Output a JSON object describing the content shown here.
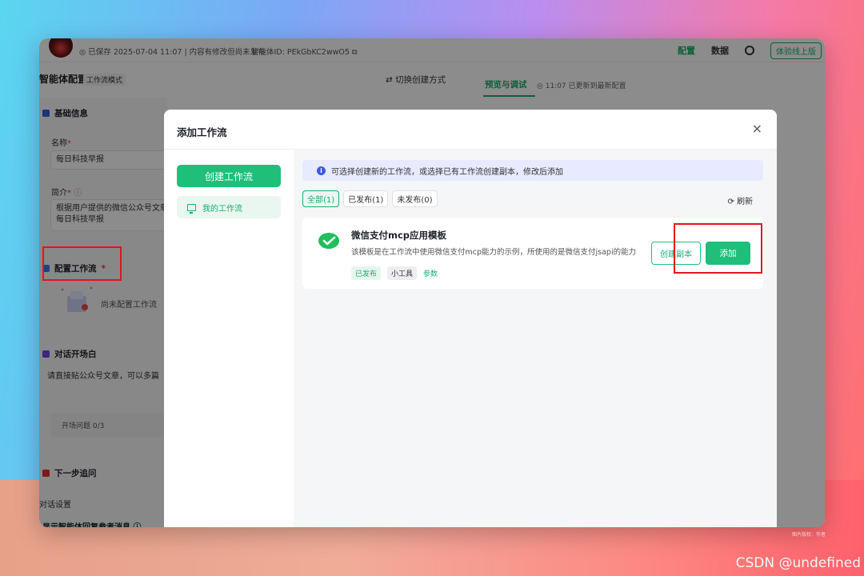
{
  "topbar": {
    "save_status": "◎ 已保存 2025-07-04 11:07 | 内容有修改但尚未发布",
    "agent_id": "智能体ID: PEkGbKC2wwO5 ⧉",
    "config": "配置",
    "data": "数据",
    "experience": "体验线上版"
  },
  "subbar": {
    "page_title": "智能体配置",
    "mode_tag": "工作流模式",
    "switch_mode": "⇄ 切换创建方式",
    "preview_tab": "预览与调试",
    "update_status": "◎ 11:07 已更新到最新配置"
  },
  "left": {
    "basic_info": "基础信息",
    "name_label": "名称",
    "name_value": "每日科技早报",
    "intro_label": "简介",
    "intro_value": "根据用户提供的微信公众号文章,\n每日科技早报",
    "config_workflow": "配置工作流",
    "empty_workflow": "尚未配置工作流",
    "opener": "对话开场白",
    "opener_text": "请直接贴公众号文章，可以多篇",
    "opener_questions": "开场问题 0/3",
    "next_step": "下一步追问",
    "chat_settings": "对话设置",
    "show_ref": "显示智能体回复参考消息 ⓘ"
  },
  "modal": {
    "title": "添加工作流",
    "close": "×",
    "create_button": "创建工作流",
    "my_workflows": "我的工作流",
    "info": "可选择创建新的工作流，或选择已有工作流创建副本，修改后添加",
    "filters": [
      "全部(1)",
      "已发布(1)",
      "未发布(0)"
    ],
    "refresh": "⟳ 刷新",
    "card": {
      "title": "微信支付mcp应用模板",
      "desc": "该模板是在工作流中使用微信支付mcp能力的示例，所使用的是微信支付jsapi的能力",
      "tag_published": "已发布",
      "tag_tool": "小工具",
      "params": "参数",
      "copy_button": "创建副本",
      "add_button": "添加"
    }
  },
  "watermark": "CSDN @undefined",
  "copyright": "图片版权：作者",
  "colors": {
    "accent": "#1fbf7a",
    "highlight": "#e0161c",
    "info_bg": "#e8eaff"
  }
}
